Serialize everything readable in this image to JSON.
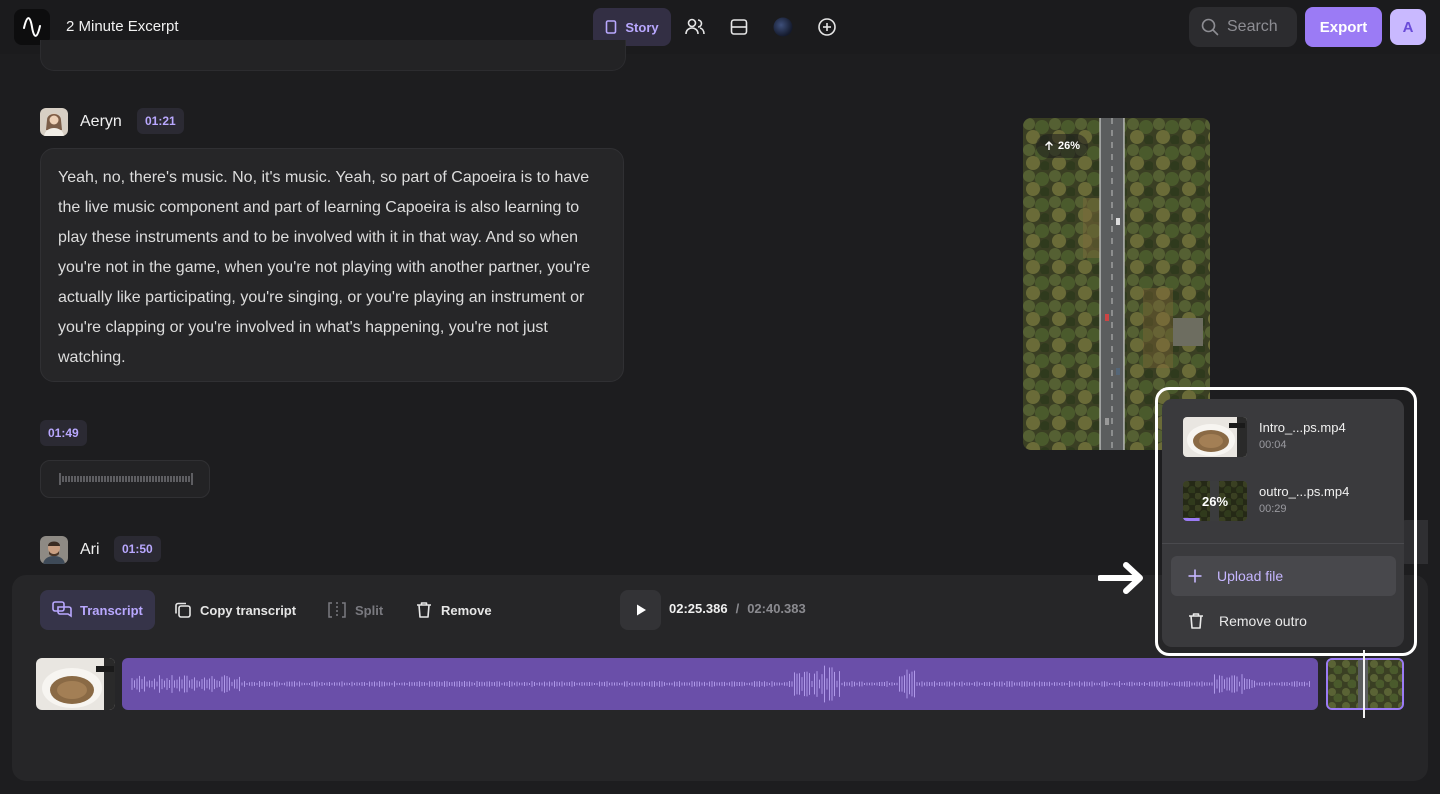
{
  "header": {
    "project_title": "2 Minute Excerpt",
    "story_label": "Story",
    "search_placeholder": "Search",
    "export_label": "Export",
    "user_initial": "A"
  },
  "transcript": {
    "blocks": [
      {
        "speaker": "Aeryn",
        "time": "01:21",
        "text": "Yeah, no, there's music. No, it's music. Yeah, so part of Capoeira is to have the live music component and part of learning Capoeira is also learning to play these instruments and to be involved with it in that way. And so when you're not in the game, when you're not playing with another partner, you're actually like participating, you're singing, or you're playing an instrument or you're clapping or you're involved in what's happening, you're not just watching."
      },
      {
        "speaker": "",
        "time": "01:49",
        "text": ""
      },
      {
        "speaker": "Ari",
        "time": "01:50",
        "text": ""
      }
    ]
  },
  "preview": {
    "upload_progress": "26%"
  },
  "toolbar": {
    "transcript_label": "Transcript",
    "copy_transcript_label": "Copy transcript",
    "split_label": "Split",
    "remove_label": "Remove",
    "current_time": "02:25.386",
    "separator": "/",
    "total_time": "02:40.383"
  },
  "outro_menu": {
    "files": [
      {
        "name": "Intro_...ps.mp4",
        "duration": "00:04",
        "progress": ""
      },
      {
        "name": "outro_...ps.mp4",
        "duration": "00:29",
        "progress": "26%"
      }
    ],
    "upload_label": "Upload file",
    "remove_label": "Remove outro"
  },
  "colors": {
    "accent": "#9b7bf5",
    "accent_text": "#b9a8ff",
    "background": "#1d1d1f",
    "audio_track": "#6a4fa9"
  }
}
